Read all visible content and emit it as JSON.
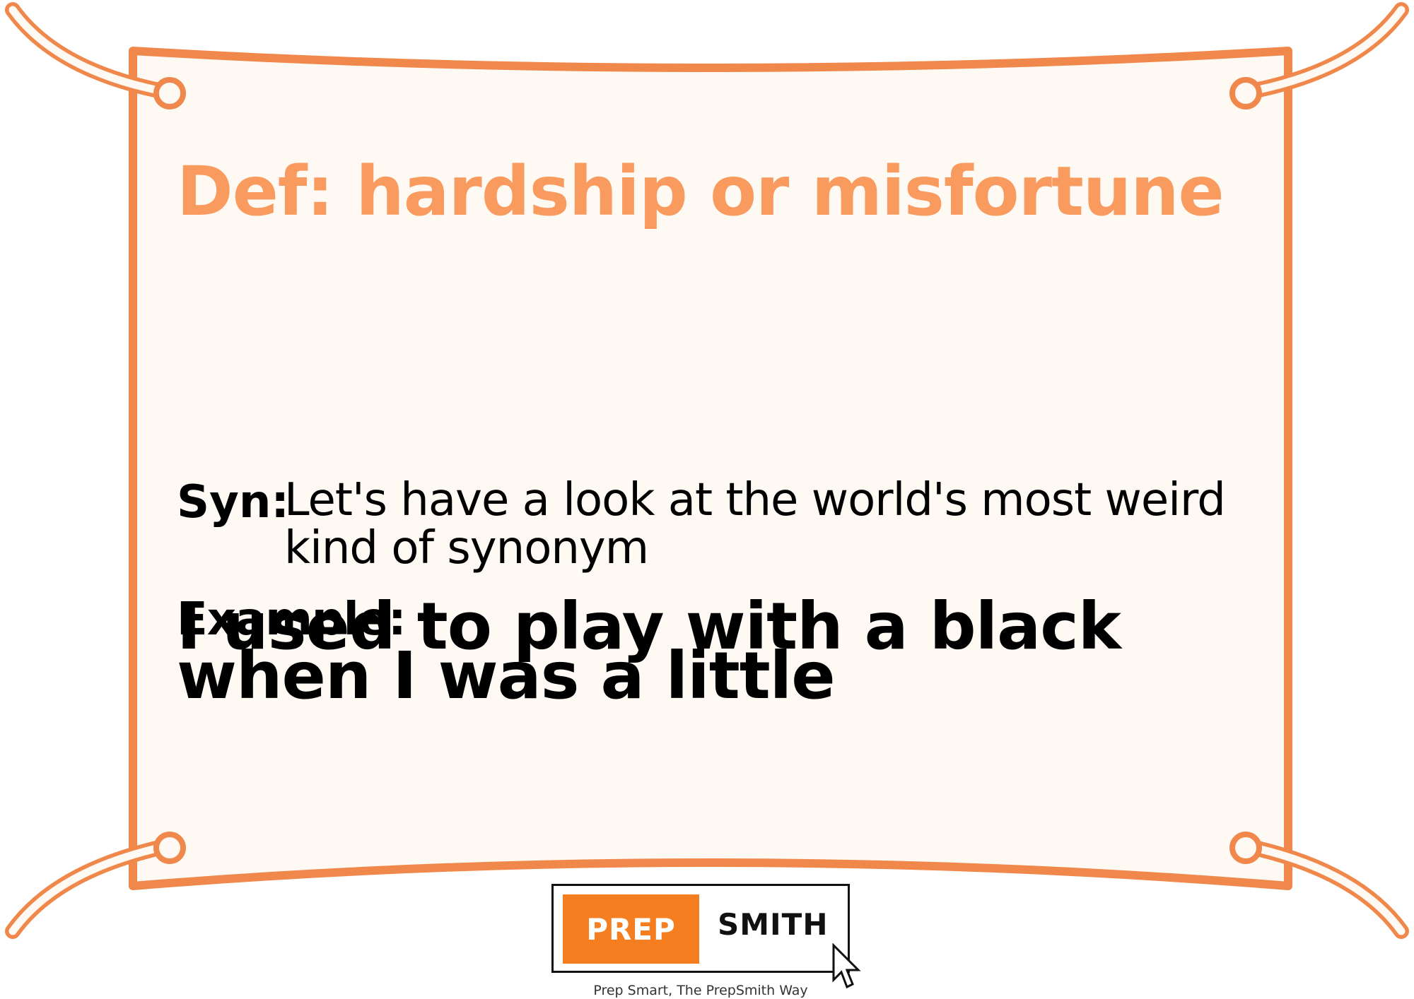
{
  "card": {
    "definition": "Def: hardship or misfortune",
    "syn_label": "Syn:",
    "syn_text": "Let's have a look at the world's most weird kind of synonym",
    "example_label": "Example:",
    "example_text": "I used to play with a black when I was a little"
  },
  "logo": {
    "prep": "PREP",
    "smith": "SMITH",
    "tagline": "Prep Smart, The PrepSmith Way"
  },
  "colors": {
    "border": "#f0884b",
    "background": "#fef9f3",
    "title": "#f99a5e",
    "logo_accent": "#f47e20"
  }
}
